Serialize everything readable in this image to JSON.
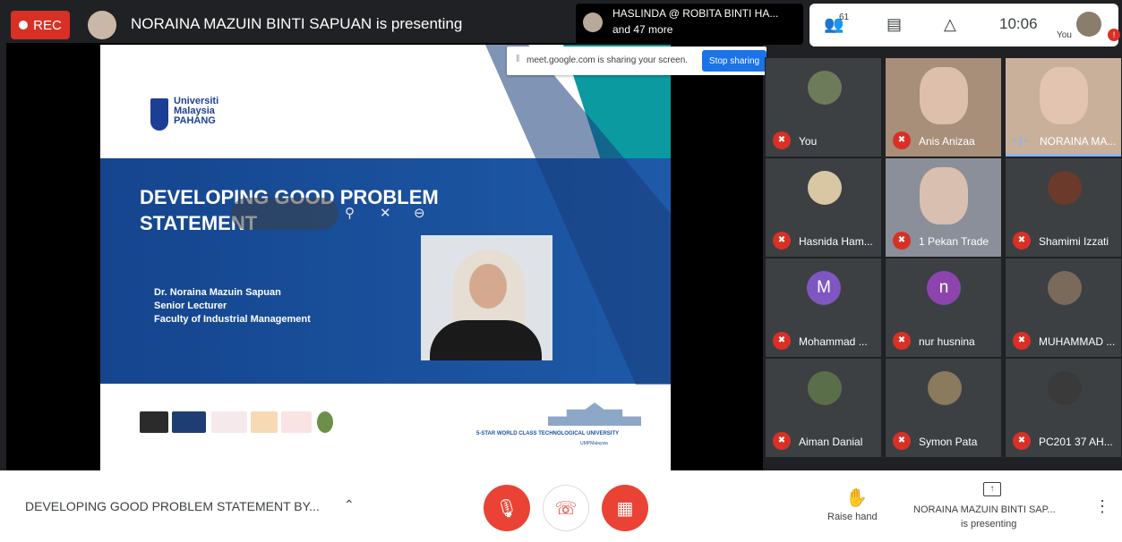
{
  "top_bar": {
    "rec_label": "REC",
    "presenting_text": "NORAINA MAZUIN BINTI SAPUAN is presenting",
    "attendee_name": "HASLINDA @ ROBITA BINTI HA...",
    "attendee_more": "and 47 more",
    "participant_count": "61",
    "time": "10:06",
    "you_label": "You"
  },
  "share_notice": {
    "text": "meet.google.com is sharing your screen.",
    "stop_label": "Stop sharing"
  },
  "slide": {
    "university": [
      "Universiti",
      "Malaysia",
      "PAHANG"
    ],
    "title_line1": "DEVELOPING GOOD PROBLEM",
    "title_line2": "STATEMENT",
    "author_name": "Dr. Noraina Mazuin Sapuan",
    "author_role": "Senior Lecturer",
    "author_faculty": "Faculty of Industrial Management",
    "tagline": "5-STAR WORLD CLASS TECHNOLOGICAL UNIVERSITY",
    "social": "UMPMalaysia"
  },
  "participants": [
    {
      "name": "You",
      "type": "avatar",
      "color": "#6d7b5a"
    },
    {
      "name": "Anis Anizaa",
      "type": "video",
      "color": "#a88f7a"
    },
    {
      "name": "NORAINA MA...",
      "type": "video",
      "color": "#c9b09b",
      "speaking": true
    },
    {
      "name": "Hasnida Ham...",
      "type": "avatar",
      "color": "#d9c7a4"
    },
    {
      "name": "1 Pekan Trade",
      "type": "video",
      "color": "#8a8f99"
    },
    {
      "name": "Shamimi Izzati",
      "type": "avatar",
      "color": "#6b3a2a"
    },
    {
      "name": "Mohammad ...",
      "type": "letter",
      "letter": "M",
      "color": "#7e57c2"
    },
    {
      "name": "nur husnina",
      "type": "letter",
      "letter": "n",
      "color": "#8e44ad"
    },
    {
      "name": "MUHAMMAD ...",
      "type": "avatar",
      "color": "#7a6a5c"
    },
    {
      "name": "Aiman Danial",
      "type": "avatar",
      "color": "#5b6e4a"
    },
    {
      "name": "Symon Pata",
      "type": "avatar",
      "color": "#8a7a5e"
    },
    {
      "name": "PC201 37 AH...",
      "type": "avatar",
      "color": "#3a3a3a"
    }
  ],
  "bottom_bar": {
    "meeting_title": "DEVELOPING GOOD PROBLEM STATEMENT BY...",
    "raise_hand_label": "Raise hand",
    "presenting_line1": "NORAINA MAZUIN BINTI SAP...",
    "presenting_line2": "is presenting"
  }
}
